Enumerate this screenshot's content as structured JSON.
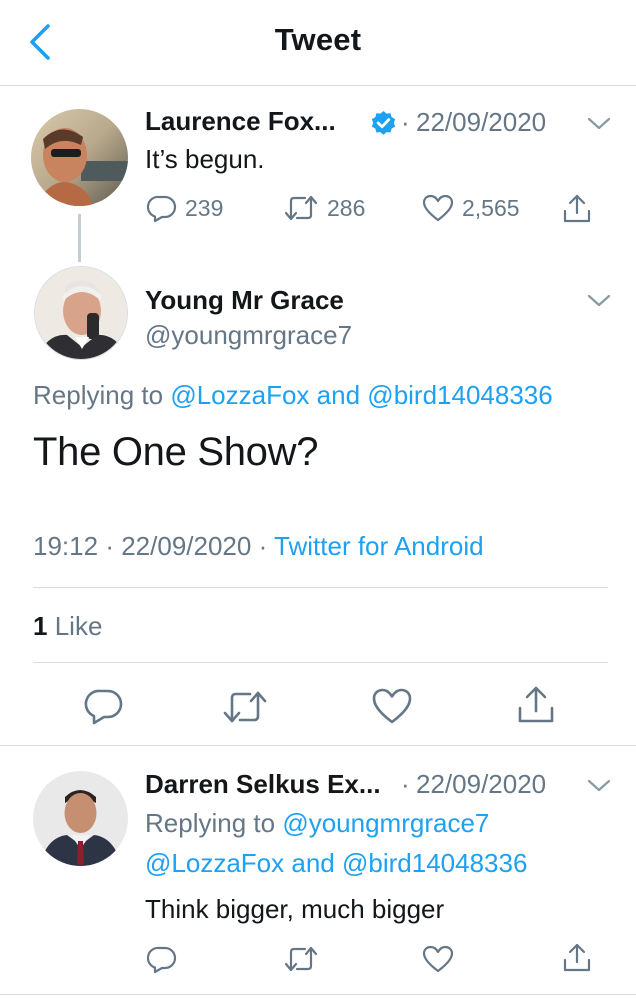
{
  "header": {
    "title": "Tweet",
    "back_icon": "chevron-left-icon"
  },
  "colors": {
    "accent": "#1da1f2",
    "secondary_text": "#657786",
    "divider": "#d8dde2"
  },
  "parent_tweet": {
    "author": "Laurence Fox...",
    "verified": true,
    "sep": "·",
    "date": "22/09/2020",
    "text": "It’s begun.",
    "replies": "239",
    "retweets": "286",
    "likes": "2,565"
  },
  "main_tweet": {
    "author": "Young Mr Grace",
    "handle": "@youngmrgrace7",
    "replying_prefix": "Replying to",
    "replying_user1": "@LozzaFox",
    "replying_and": "and",
    "replying_user2": "@bird14048336",
    "text": "The One Show?",
    "time": "19:12",
    "sep1": "·",
    "date": "22/09/2020",
    "sep2": "·",
    "source": "Twitter for Android",
    "like_count": "1",
    "like_label": "Like"
  },
  "reply_tweet": {
    "author": "Darren Selkus Ex...",
    "sep": "·",
    "date": "22/09/2020",
    "replying_prefix": "Replying to",
    "replying_user1": "@youngmrgrace7",
    "replying_user2": "@LozzaFox",
    "replying_and": "and",
    "replying_user3": "@bird14048336",
    "text": "Think bigger, much bigger"
  }
}
